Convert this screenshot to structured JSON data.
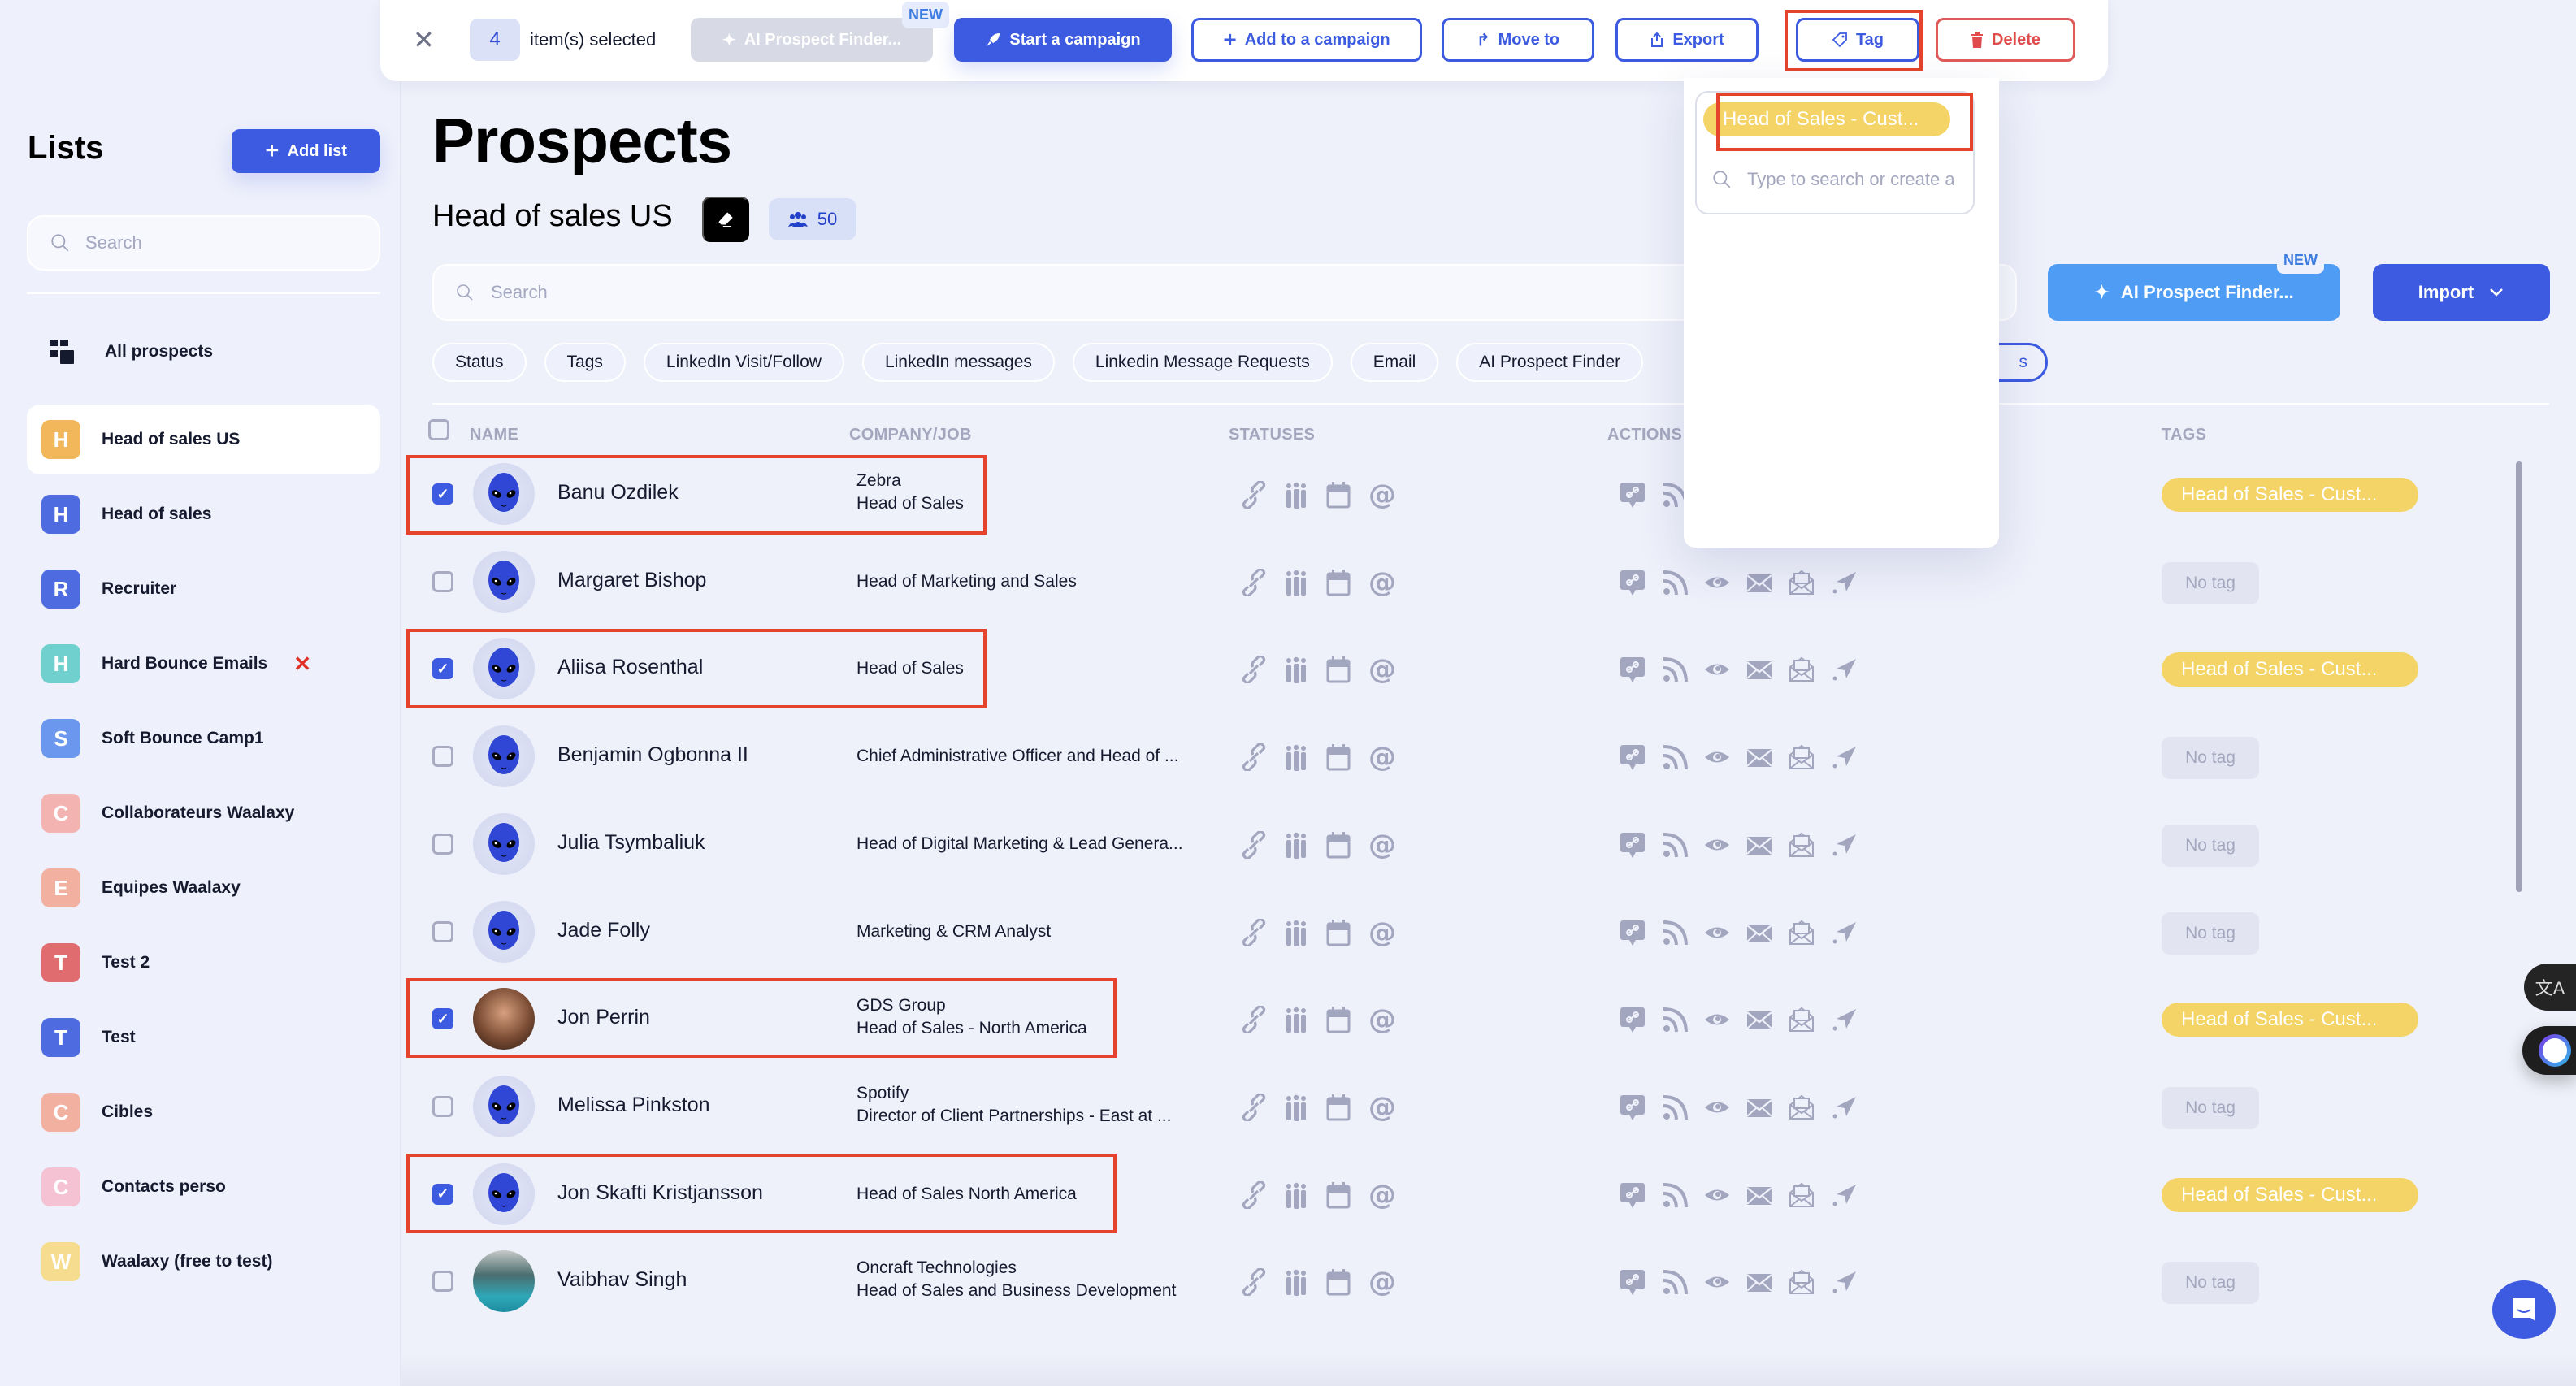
{
  "sidebar": {
    "title": "Lists",
    "add_list_label": "Add list",
    "search_placeholder": "Search",
    "all_prospects_label": "All prospects",
    "items": [
      {
        "initial": "H",
        "label": "Head of sales US",
        "color": "#f2b75a",
        "active": true
      },
      {
        "initial": "H",
        "label": "Head of sales",
        "color": "#4f6be0"
      },
      {
        "initial": "R",
        "label": "Recruiter",
        "color": "#4f6be0"
      },
      {
        "initial": "H",
        "label": "Hard Bounce Emails",
        "color": "#6fd0cd",
        "suffix_icon": "red-cross-icon",
        "suffix": "✕"
      },
      {
        "initial": "S",
        "label": "Soft Bounce Camp1",
        "color": "#6b97ef"
      },
      {
        "initial": "C",
        "label": "Collaborateurs Waalaxy",
        "color": "#f3b3b0"
      },
      {
        "initial": "E",
        "label": "Equipes Waalaxy",
        "color": "#f2b1a0"
      },
      {
        "initial": "T",
        "label": "Test 2",
        "color": "#e06c6f"
      },
      {
        "initial": "T",
        "label": "Test",
        "color": "#4f6be0"
      },
      {
        "initial": "C",
        "label": "Cibles",
        "color": "#f2b1a0"
      },
      {
        "initial": "C",
        "label": "Contacts perso",
        "color": "#f4c2d3"
      },
      {
        "initial": "W",
        "label": "Waalaxy (free to test)",
        "color": "#f5dc8e"
      }
    ]
  },
  "action_bar": {
    "selected_count": "4",
    "selected_label": "item(s) selected",
    "ai_finder_label": "AI Prospect Finder...",
    "new_badge": "NEW",
    "start_campaign_label": "Start a campaign",
    "add_to_campaign_label": "Add to a campaign",
    "move_to_label": "Move to",
    "export_label": "Export",
    "tag_label": "Tag",
    "delete_label": "Delete"
  },
  "tag_dropdown": {
    "option_label": "Head of Sales - Cust...",
    "search_placeholder": "Type to search or create a tag"
  },
  "main": {
    "page_title": "Prospects",
    "list_title": "Head of sales US",
    "prospect_count": "50",
    "search_placeholder": "Search",
    "ai_finder_label": "AI Prospect Finder...",
    "new_badge": "NEW",
    "import_label": "Import",
    "filters": [
      "Status",
      "Tags",
      "LinkedIn Visit/Follow",
      "LinkedIn messages",
      "Linkedin Message Requests",
      "Email",
      "AI Prospect Finder"
    ],
    "hidden_filter_tail": "s",
    "columns": {
      "name": "NAME",
      "company": "COMPANY/JOB",
      "statuses": "STATUSES",
      "actions": "ACTIONS",
      "tags": "TAGS"
    },
    "rows": [
      {
        "name": "Banu Ozdilek",
        "company": "Zebra",
        "job": "Head of Sales",
        "checked": true,
        "avatar": "alien",
        "tag": "Head of Sales - Cust...",
        "full_actions": false
      },
      {
        "name": "Margaret Bishop",
        "company": "",
        "job": "Head of Marketing and Sales",
        "checked": false,
        "avatar": "alien",
        "tag": "No tag",
        "full_actions": true
      },
      {
        "name": "Aliisa Rosenthal",
        "company": "",
        "job": "Head of Sales",
        "checked": true,
        "avatar": "alien",
        "tag": "Head of Sales - Cust...",
        "full_actions": true
      },
      {
        "name": "Benjamin Ogbonna II",
        "company": "",
        "job": "Chief Administrative Officer and Head of ...",
        "checked": false,
        "avatar": "alien",
        "tag": "No tag",
        "full_actions": true
      },
      {
        "name": "Julia Tsymbaliuk",
        "company": "",
        "job": "Head of Digital Marketing & Lead Genera...",
        "checked": false,
        "avatar": "alien",
        "tag": "No tag",
        "full_actions": true
      },
      {
        "name": "Jade Folly",
        "company": "",
        "job": "Marketing & CRM Analyst",
        "checked": false,
        "avatar": "alien",
        "tag": "No tag",
        "full_actions": true
      },
      {
        "name": "Jon Perrin",
        "company": "GDS Group",
        "job": "Head of Sales - North America",
        "checked": true,
        "avatar": "photo",
        "tag": "Head of Sales - Cust...",
        "full_actions": true
      },
      {
        "name": "Melissa Pinkston",
        "company": "Spotify",
        "job": "Director of Client Partnerships - East at ...",
        "checked": false,
        "avatar": "alien",
        "tag": "No tag",
        "full_actions": true
      },
      {
        "name": "Jon Skafti Kristjansson",
        "company": "",
        "job": "Head of Sales North America",
        "checked": true,
        "avatar": "alien",
        "tag": "Head of Sales - Cust...",
        "full_actions": true
      },
      {
        "name": "Vaibhav Singh",
        "company": "Oncraft Technologies",
        "job": "Head of Sales and Business Development",
        "checked": false,
        "avatar": "photo2",
        "tag": "No tag",
        "full_actions": true
      }
    ]
  },
  "floating": {
    "translate_icon": "translate-icon",
    "assistant_icon": "assistant-bot-icon",
    "chat_icon": "chat-support-icon"
  },
  "colors": {
    "primary": "#3d5be0",
    "ai_blue": "#4f9cf5",
    "tag_yellow": "#f4d466",
    "danger": "#e04b4b",
    "highlight": "#e5432b"
  }
}
